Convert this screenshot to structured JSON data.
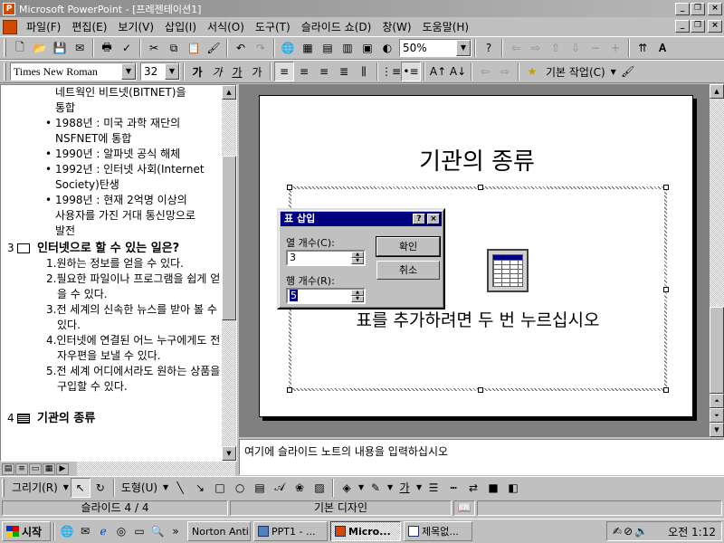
{
  "window": {
    "title": "Microsoft PowerPoint - [프레젠테이션1]",
    "app_icon": "powerpoint-icon"
  },
  "menu": {
    "items": [
      "파일(F)",
      "편집(E)",
      "보기(V)",
      "삽입(I)",
      "서식(O)",
      "도구(T)",
      "슬라이드 쇼(D)",
      "창(W)",
      "도움말(H)"
    ]
  },
  "toolbar": {
    "zoom": "50%"
  },
  "format_toolbar": {
    "font": "Times New Roman",
    "size": "32",
    "design_label": "기본 작업(C)"
  },
  "outline": {
    "slide3_bullets_top": [
      {
        "lines": [
          "네트웍인 비트넷(BITNET)을",
          "통합"
        ],
        "continued": true
      },
      {
        "lines": [
          "1988년 : 미국 과학 재단의",
          "NSFNET에 통합"
        ]
      },
      {
        "lines": [
          "1990년 : 알파넷 공식 해체"
        ]
      },
      {
        "lines": [
          "1992년 : 인터넷 사회(Internet",
          "Society)탄생"
        ]
      },
      {
        "lines": [
          "1998년 : 현재 2억명 이상의",
          "사용자를 가진 거대 통신망으로",
          "발전"
        ]
      }
    ],
    "slide3": {
      "number": "3",
      "title": "인터넷으로 할 수 있는 일은?",
      "items": [
        "1.원하는 정보를 얻을 수 있다.",
        "2.필요한 파일이나 프로그램을 쉽게 얻을 수 있다.",
        "3.전 세계의 신속한 뉴스를 받아 볼 수 있다.",
        "4.인터넷에 연결된 어느 누구에게도 전자우편을 보낼 수 있다.",
        "5.전 세계 어디에서라도 원하는 상품을 구입할 수 있다."
      ]
    },
    "slide4": {
      "number": "4",
      "title": "기관의 종류"
    }
  },
  "slide": {
    "title": "기관의 종류",
    "placeholder_text": "표를 추가하려면 두 번 누르십시오"
  },
  "notes": {
    "placeholder": "여기에 슬라이드 노트의 내용을 입력하십시오"
  },
  "dialog": {
    "title": "표 삽입",
    "columns_label": "열 개수(C):",
    "columns_value": "3",
    "rows_label": "행 개수(R):",
    "rows_value": "5",
    "ok_label": "확인",
    "cancel_label": "취소"
  },
  "drawing_toolbar": {
    "draw_label": "그리기(R)",
    "autoshape_label": "도형(U)"
  },
  "status": {
    "slide": "슬라이드 4 / 4",
    "design": "기본 디자인"
  },
  "taskbar": {
    "start_label": "시작",
    "tasks": [
      "Norton Anti...",
      "PPT1 - ...",
      "Micro...",
      "제목없..."
    ],
    "clock": "오전 1:12"
  }
}
